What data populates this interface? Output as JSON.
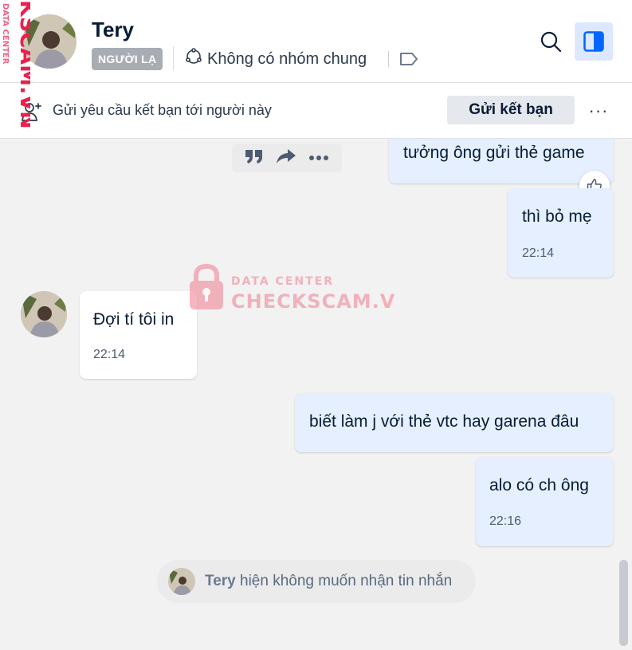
{
  "header": {
    "contact_name": "Tery",
    "badge": "NGƯỜI LẠ",
    "groups_label": "Không có nhóm chung"
  },
  "friend_bar": {
    "text": "Gửi yêu cầu kết bạn tới người này",
    "button": "Gửi kết bạn",
    "more": "···"
  },
  "messages": [
    {
      "direction": "out",
      "text": "tưởng ông gửi thẻ game"
    },
    {
      "direction": "out",
      "text": "thì bỏ mẹ",
      "time": "22:14"
    },
    {
      "direction": "in",
      "text": "Đợi tí tôi in",
      "time": "22:14"
    },
    {
      "direction": "out",
      "text": "biết làm j với thẻ vtc hay garena đâu"
    },
    {
      "direction": "out",
      "text": "alo có ch ông",
      "time": "22:16"
    }
  ],
  "notice": {
    "name": "Tery",
    "text": "hiện không muốn nhận tin nhắn"
  },
  "watermark": {
    "side": "KSCAM.VN",
    "side_small": "DATA CENTER",
    "center_top": "DATA CENTER",
    "center_bottom": "CHECKSCAM.VN"
  },
  "colors": {
    "accent": "#0068ff",
    "outgoing_bubble": "#e5efff",
    "incoming_bubble": "#ffffff",
    "watermark": "#f07c8f"
  },
  "icons": [
    "search-icon",
    "panel-toggle-icon",
    "group-icon",
    "tag-icon",
    "add-friend-icon",
    "quote-icon",
    "forward-icon",
    "more-icon",
    "like-icon"
  ]
}
